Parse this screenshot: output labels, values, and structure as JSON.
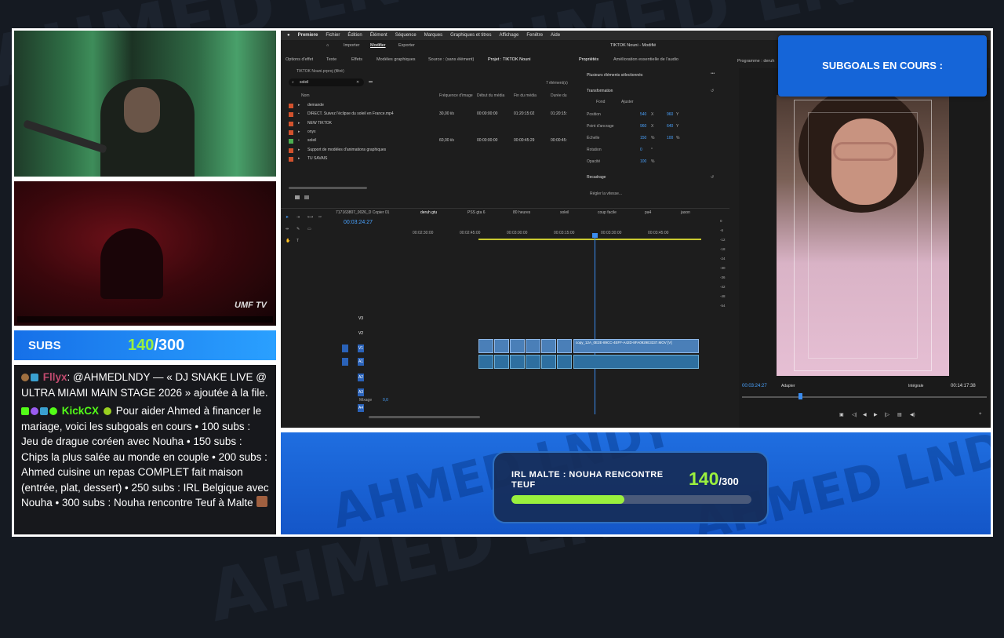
{
  "background": {
    "watermark": "AHMED LNDY"
  },
  "subs_bar": {
    "label": "SUBS",
    "current": "140",
    "goal": "/300"
  },
  "chat": {
    "messages": [
      {
        "user": "Fllyx",
        "user_color": "#c04a6e",
        "text": ": @AHMEDLNDY — « DJ SNAKE LIVE @ ULTRA MIAMI MAIN STAGE 2026 » ajoutée à la file."
      },
      {
        "user": "KickCX",
        "user_color": "#53fc18",
        "text": " Pour aider Ahmed à financer le mariage, voici les subgoals en cours • 100 subs : Jeu de drague coréen avec Nouha • 150 subs : Chips la plus salée au monde en couple • 200 subs : Ahmed cuisine un repas COMPLET fait maison (entrée, plat, dessert) • 250 subs : IRL Belgique avec Nouha • 300 subs : Nouha rencontre Teuf à Malte"
      }
    ]
  },
  "subgoals": {
    "title": "SUBGOALS EN COURS :"
  },
  "goal_widget": {
    "label": "IRL MALTE : NOUHA RENCONTRE TEUF",
    "current": "140",
    "target": "/300",
    "progress": 0.47
  },
  "video2": {
    "logo": "UMF TV"
  },
  "premiere": {
    "menu": [
      "Premiere",
      "Fichier",
      "Édition",
      "Élément",
      "Séquence",
      "Marques",
      "Graphiques et titres",
      "Affichage",
      "Fenêtre",
      "Aide"
    ],
    "workspace_tabs": [
      "Importer",
      "Modifier",
      "Exporter"
    ],
    "doc_title": "TIKTOK Nouni - Modifié",
    "panel_tabs": [
      "Options d'effet",
      "Texte",
      "Effets",
      "Modèles graphiques",
      "Source : (sans élément)",
      "Projet : TIKTOK Nouni"
    ],
    "project_path": "TIKTOK Nouni.prproj (filtré)",
    "search": "soleil",
    "items_count": "7 élément(s)",
    "columns": [
      "Nom",
      "Fréquence d'image",
      "Début du média",
      "Fin du média",
      "Durée du"
    ],
    "files": [
      {
        "name": "demande",
        "color": "#d2522d",
        "fps": "",
        "start": "",
        "end": "",
        "dur": ""
      },
      {
        "name": "DIRECT. Suivez l'éclipse du soleil en France.mp4",
        "color": "#d2522d",
        "fps": "30,00 i/s",
        "start": "00:00:00:00",
        "end": "01:20:15:02",
        "dur": "01:20:15:"
      },
      {
        "name": "NEW TIKTOK",
        "color": "#d2522d",
        "fps": "",
        "start": "",
        "end": "",
        "dur": ""
      },
      {
        "name": "onyx",
        "color": "#d2522d",
        "fps": "",
        "start": "",
        "end": "",
        "dur": ""
      },
      {
        "name": "soleil",
        "color": "#4caf50",
        "fps": "60,00 i/s",
        "start": "00:00:00:00",
        "end": "00:00:45:29",
        "dur": "00:00:45:"
      },
      {
        "name": "Support de modèles d'animations graphiques",
        "color": "#d2522d",
        "fps": "",
        "start": "",
        "end": "",
        "dur": ""
      },
      {
        "name": "TU SAVAIS",
        "color": "#d2522d",
        "fps": "",
        "start": "",
        "end": "",
        "dur": ""
      }
    ],
    "props_tabs": [
      "Propriétés",
      "Amélioration essentielle de l'audio"
    ],
    "props": {
      "multi": "Plusieurs éléments sélectionnés",
      "transform": "Transformation",
      "fond": "Fond",
      "ajuster": "Ajuster",
      "rows": [
        {
          "label": "Position",
          "v1": "540",
          "x": "X",
          "v2": "960",
          "y": "Y"
        },
        {
          "label": "Point d'ancrage",
          "v1": "960",
          "x": "X",
          "v2": "640",
          "y": "Y"
        },
        {
          "label": "Échelle",
          "v1": "150",
          "x": "%",
          "v2": "100",
          "y": "%"
        },
        {
          "label": "Rotation",
          "v1": "0",
          "x": "°",
          "v2": "",
          "y": ""
        },
        {
          "label": "Opacité",
          "v1": "100",
          "x": "%",
          "v2": "",
          "y": ""
        }
      ],
      "recadrage": "Recadrage",
      "speed": "Régler la vitesse..."
    },
    "program_label": "Programme : deruh",
    "timeline_tabs": [
      "717163807_0026_D Copier 01",
      "deruh gtu",
      "PSS gta 6",
      "80 heures",
      "soleil",
      "coup facile",
      "pa4",
      "jason"
    ],
    "timecode": "00:03:24:27",
    "ruler": [
      "00:02:30:00",
      "00:02:45:00",
      "00:03:00:00",
      "00:03:15:00",
      "00:03:30:00",
      "00:03:45:00"
    ],
    "vtracks": [
      "V3",
      "V2",
      "V1"
    ],
    "atracks": [
      "A1",
      "A2",
      "A3",
      "A4"
    ],
    "mixage": "Mixage",
    "mixage_val": "0,0",
    "clip_name": "copy_12A_0E2E-89CC-4EFF-A42D-8FA0929E3337.MOV [V]",
    "program_tc": "00:03:24:27",
    "program_fit": "Adapter",
    "program_quality": "Intégrale",
    "program_dur": "00:14:17:38",
    "vu_scale": [
      "0",
      "-6",
      "-12",
      "-18",
      "-24",
      "-30",
      "-36",
      "-42",
      "-48",
      "-54"
    ]
  }
}
